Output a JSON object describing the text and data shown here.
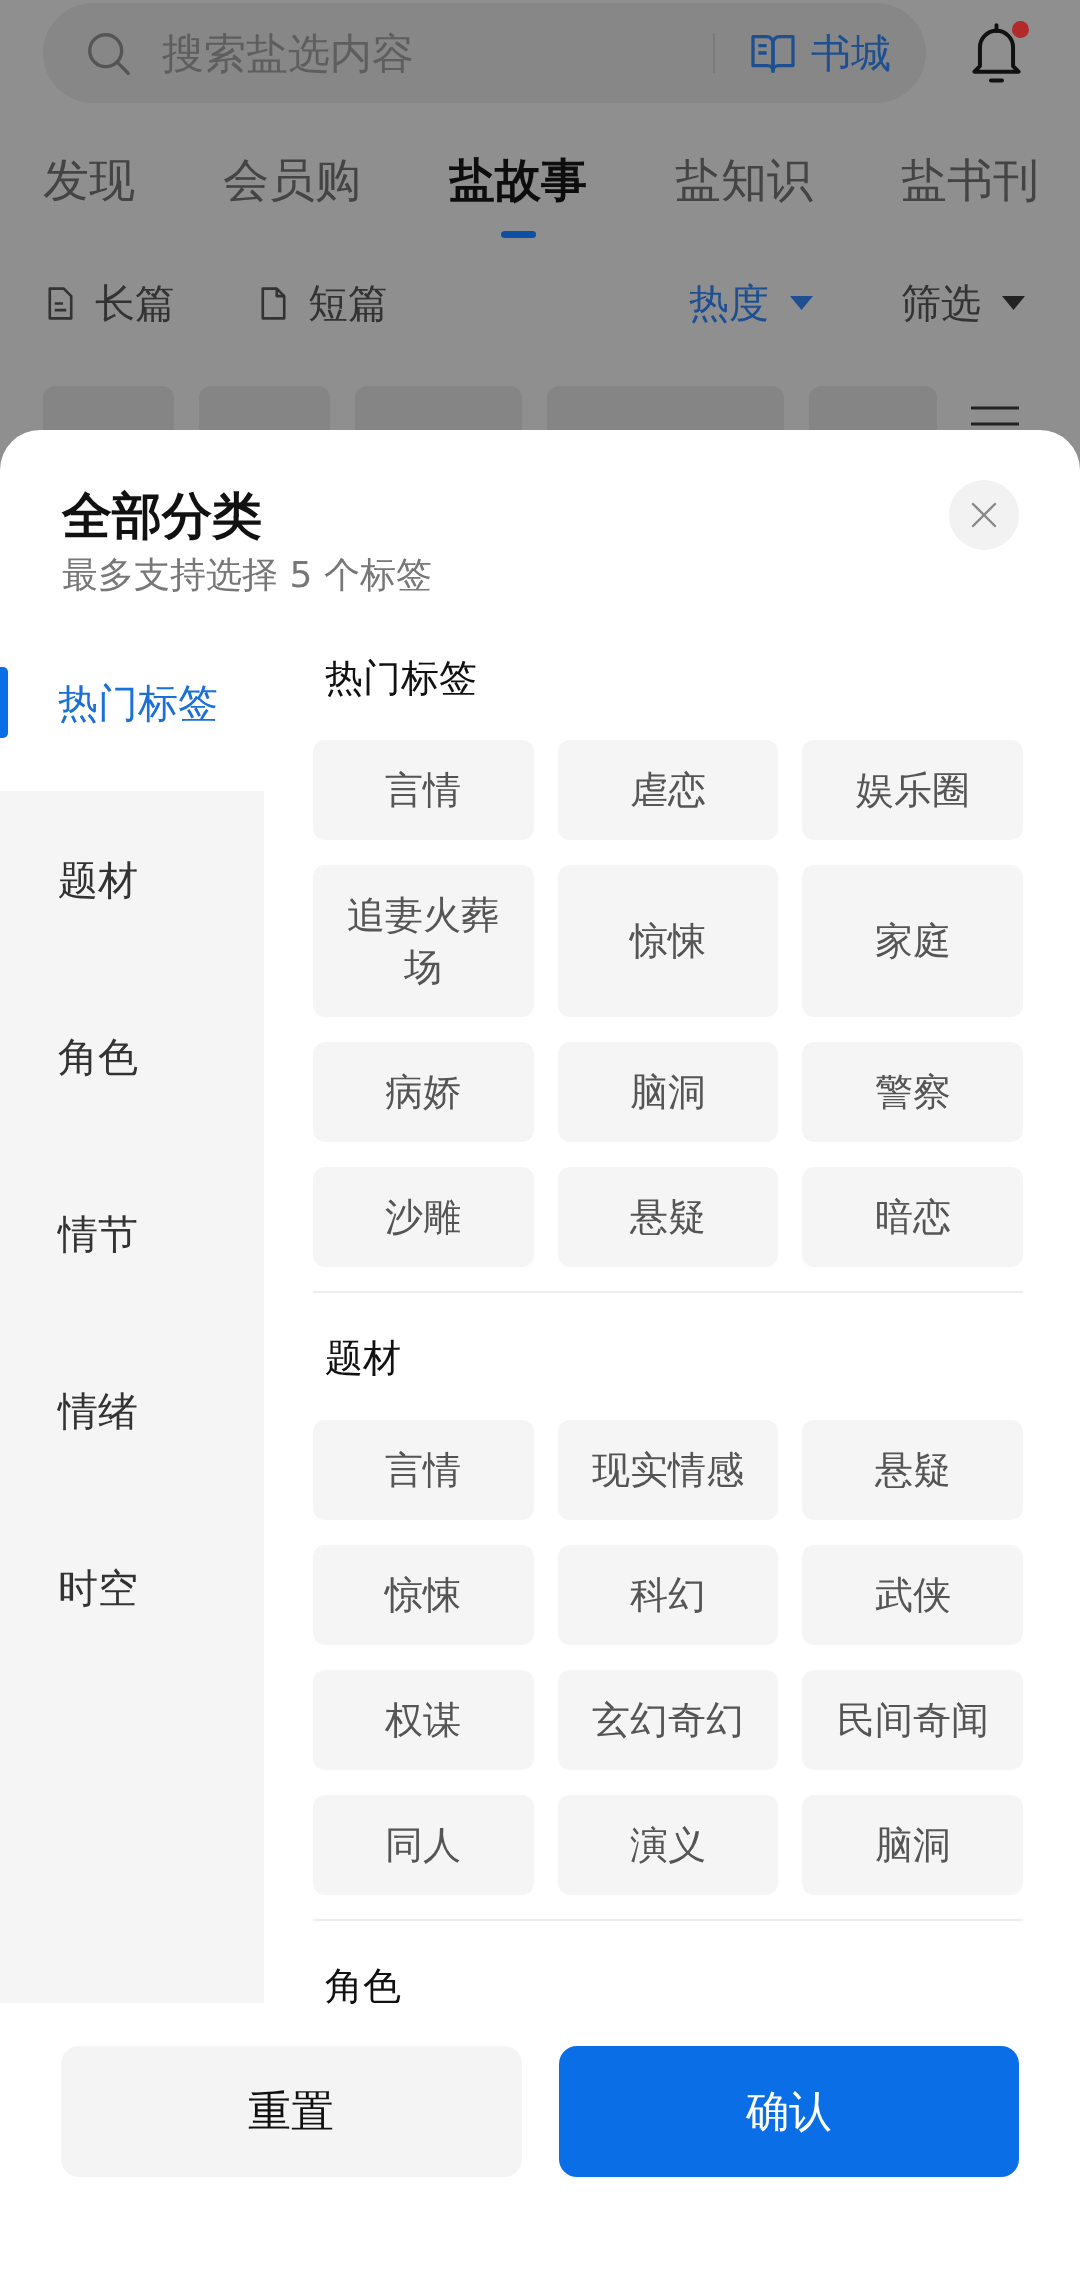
{
  "search_bar": {
    "placeholder": "搜索盐选内容",
    "bookstore_link": "书城"
  },
  "notifications": {
    "unread": true
  },
  "tabs": [
    {
      "label": "发现",
      "selected": false
    },
    {
      "label": "会员购",
      "selected": false
    },
    {
      "label": "盐故事",
      "selected": true
    },
    {
      "label": "盐知识",
      "selected": false
    },
    {
      "label": "盐书刊",
      "selected": false
    }
  ],
  "filter_bar": {
    "formats": [
      {
        "label": "长篇",
        "kind": "long"
      },
      {
        "label": "短篇",
        "kind": "short"
      }
    ],
    "sort": {
      "label": "热度",
      "active": true
    },
    "filter": {
      "label": "筛选",
      "active": false
    }
  },
  "sheet": {
    "title": "全部分类",
    "subtitle": "最多支持选择 5 个标签",
    "sidebar": [
      {
        "label": "热门标签",
        "selected": true
      },
      {
        "label": "题材",
        "selected": false
      },
      {
        "label": "角色",
        "selected": false
      },
      {
        "label": "情节",
        "selected": false
      },
      {
        "label": "情绪",
        "selected": false
      },
      {
        "label": "时空",
        "selected": false
      }
    ],
    "sections": [
      {
        "title": "热门标签",
        "tags": [
          {
            "label": "言情",
            "selected": false
          },
          {
            "label": "虐恋",
            "selected": false
          },
          {
            "label": "娱乐圈",
            "selected": false
          },
          {
            "label": "追妻火葬场",
            "selected": false
          },
          {
            "label": "惊悚",
            "selected": false
          },
          {
            "label": "家庭",
            "selected": false
          },
          {
            "label": "病娇",
            "selected": false
          },
          {
            "label": "脑洞",
            "selected": false
          },
          {
            "label": "警察",
            "selected": false
          },
          {
            "label": "沙雕",
            "selected": false
          },
          {
            "label": "悬疑",
            "selected": false
          },
          {
            "label": "暗恋",
            "selected": false
          }
        ]
      },
      {
        "title": "题材",
        "tags": [
          {
            "label": "言情",
            "selected": false
          },
          {
            "label": "现实情感",
            "selected": false
          },
          {
            "label": "悬疑",
            "selected": false
          },
          {
            "label": "惊悚",
            "selected": false
          },
          {
            "label": "科幻",
            "selected": false
          },
          {
            "label": "武侠",
            "selected": false
          },
          {
            "label": "权谋",
            "selected": false
          },
          {
            "label": "玄幻奇幻",
            "selected": false
          },
          {
            "label": "民间奇闻",
            "selected": false
          },
          {
            "label": "同人",
            "selected": false
          },
          {
            "label": "演义",
            "selected": false
          },
          {
            "label": "脑洞",
            "selected": false
          }
        ]
      },
      {
        "title": "角色"
      }
    ],
    "buttons": [
      {
        "label": "重置",
        "kind": "secondary"
      },
      {
        "label": "确认",
        "kind": "primary"
      }
    ]
  }
}
